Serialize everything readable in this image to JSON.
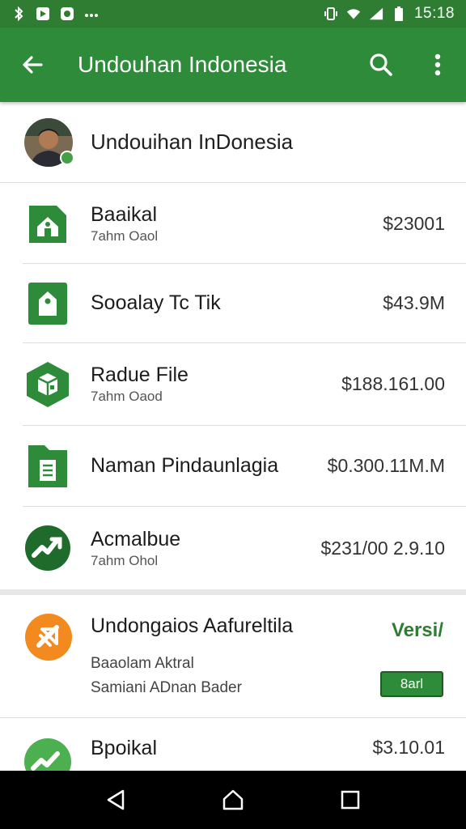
{
  "status_bar": {
    "time": "15:18",
    "left_icons": [
      "bluetooth-icon",
      "notification-app-icon",
      "notification-app-icon",
      "more-notifications-icon"
    ],
    "right_icons": [
      "vibrate-icon",
      "wifi-icon",
      "signal-icon",
      "battery-icon"
    ]
  },
  "app_bar": {
    "title": "Undouhan Indonesia",
    "back_icon": "arrow-left-icon",
    "search_icon": "search-icon",
    "menu_icon": "more-vert-icon",
    "color": "#2e8b3a"
  },
  "profile": {
    "name": "Undouihan InDonesia"
  },
  "items": [
    {
      "title": "Baaikal",
      "subtitle": "7ahm Oaol",
      "value": "$23001",
      "icon": "home-file-icon"
    },
    {
      "title": "Sooalay Tc Tik",
      "subtitle": "",
      "value": "$43.9M",
      "icon": "tag-file-icon"
    },
    {
      "title": "Radue File",
      "subtitle": "7ahm Oaod",
      "value": "$188.161.00",
      "icon": "package-icon"
    },
    {
      "title": "Naman Pindaunlagia",
      "subtitle": "",
      "value": "$0.300.11M.M",
      "icon": "document-icon"
    },
    {
      "title": "Acmalbue",
      "subtitle": "7ahm Ohol",
      "value": "$231/00 2.9.10",
      "icon": "trend-icon"
    }
  ],
  "featured": {
    "title": "Undongaios Aafureltila",
    "line1": "Baaolam Aktral",
    "line2": "Samiani ADnan Bader",
    "version_label": "Versi/",
    "badge": "8arl",
    "icon": "download-orange-icon"
  },
  "last_item": {
    "title": "Bpoikal",
    "value": "$3.10.01",
    "icon": "trend-icon"
  },
  "nav": {
    "back": "nav-back-icon",
    "home": "nav-home-icon",
    "recents": "nav-recents-icon"
  },
  "colors": {
    "primary": "#2e8b3a",
    "primary_dark": "#2e7d32",
    "accent_orange": "#f28a1f"
  }
}
